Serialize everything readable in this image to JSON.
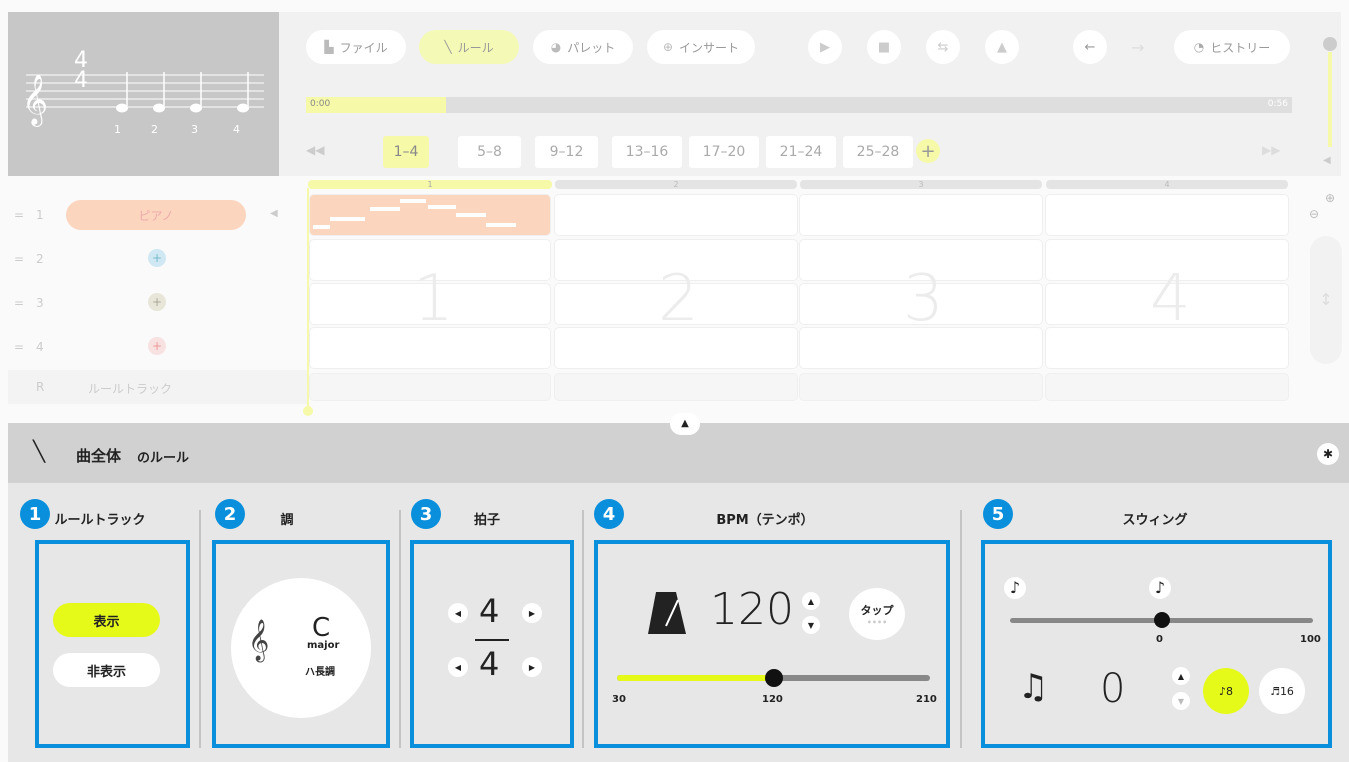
{
  "preview": {
    "time_top": "4",
    "time_bottom": "4",
    "beats": [
      "1",
      "2",
      "3",
      "4"
    ]
  },
  "toolbar": {
    "file": "ファイル",
    "rule": "ルール",
    "palette": "パレット",
    "insert": "インサート",
    "history": "ヒストリー"
  },
  "timeline": {
    "start": "0:00",
    "end": "0:56"
  },
  "segments": [
    "1–4",
    "5–8",
    "9–12",
    "13–16",
    "17–20",
    "21–24",
    "25–28"
  ],
  "measures": [
    "1",
    "2",
    "3",
    "4"
  ],
  "tracks": [
    {
      "num": "1",
      "label": "ピアノ"
    },
    {
      "num": "2",
      "label": ""
    },
    {
      "num": "3",
      "label": ""
    },
    {
      "num": "4",
      "label": ""
    },
    {
      "num": "R",
      "label": "ルールトラック"
    }
  ],
  "rule": {
    "title": "曲全体",
    "title_suffix": "のルール"
  },
  "sections": {
    "track": {
      "badge": "1",
      "title": "ルールトラック",
      "show": "表示",
      "hide": "非表示"
    },
    "key": {
      "badge": "2",
      "title": "調",
      "note": "C",
      "mode": "major",
      "jp": "ハ長調"
    },
    "meter": {
      "badge": "3",
      "title": "拍子",
      "top": "4",
      "bottom": "4"
    },
    "bpm": {
      "badge": "4",
      "title": "BPM（テンポ）",
      "value": "120",
      "tap": "タップ",
      "min": "30",
      "mid": "120",
      "max": "210",
      "level": 0.5
    },
    "swing": {
      "badge": "5",
      "title": "スウィング",
      "zero": "0",
      "max": "100",
      "value": "0",
      "eighth": "8",
      "sixteenth": "16",
      "level": 0.5
    }
  },
  "colors": {
    "accent": "#e6fa1a",
    "blue": "#0a8fdc",
    "piano": "#fcd5bf"
  }
}
